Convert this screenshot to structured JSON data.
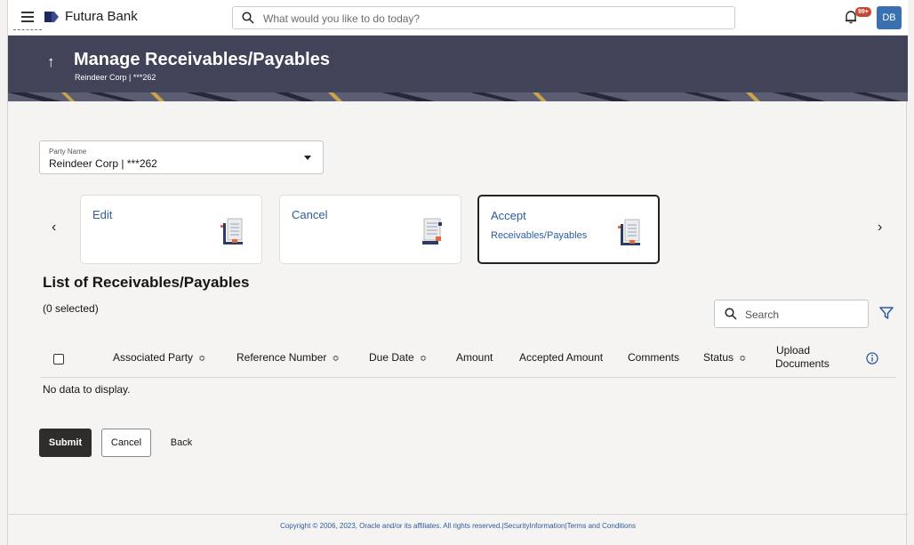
{
  "app": {
    "brand": "Futura Bank",
    "search_placeholder": "What would you like to do today?",
    "notification_badge": "99+",
    "avatar_initials": "DB"
  },
  "header": {
    "title": "Manage Receivables/Payables",
    "subtitle": "Reindeer Corp | ***262"
  },
  "party": {
    "label": "Party Name",
    "value": "Reindeer Corp | ***262"
  },
  "cards": [
    {
      "label": "Edit",
      "label2": ""
    },
    {
      "label": "Cancel",
      "label2": ""
    },
    {
      "label": "Accept",
      "label2": "Receivables/Payables"
    }
  ],
  "list": {
    "title": "List of Receivables/Payables",
    "selected": "(0 selected)",
    "search_placeholder": "Search",
    "columns": [
      "Associated Party",
      "Reference Number",
      "Due Date",
      "Amount",
      "Accepted Amount",
      "Comments",
      "Status",
      "Upload",
      "Documents"
    ],
    "empty_text": "No data to display."
  },
  "actions": {
    "submit": "Submit",
    "cancel": "Cancel",
    "back": "Back"
  },
  "footer": {
    "text": "Copyright © 2006, 2023, Oracle and/or its affiliates. All rights reserved.|SecurityInformation|Terms and Conditions"
  },
  "colors": {
    "banner": "#414358",
    "accent_link": "#2b5d9b",
    "primary_button": "#2e2d2b",
    "badge": "#c74634"
  },
  "icons": [
    "hamburger-menu-icon",
    "futura-logo-icon",
    "search-icon",
    "bell-icon",
    "chevron-left-icon",
    "chevron-right-icon",
    "filter-icon",
    "info-icon",
    "sort-icon",
    "caret-down-icon"
  ]
}
